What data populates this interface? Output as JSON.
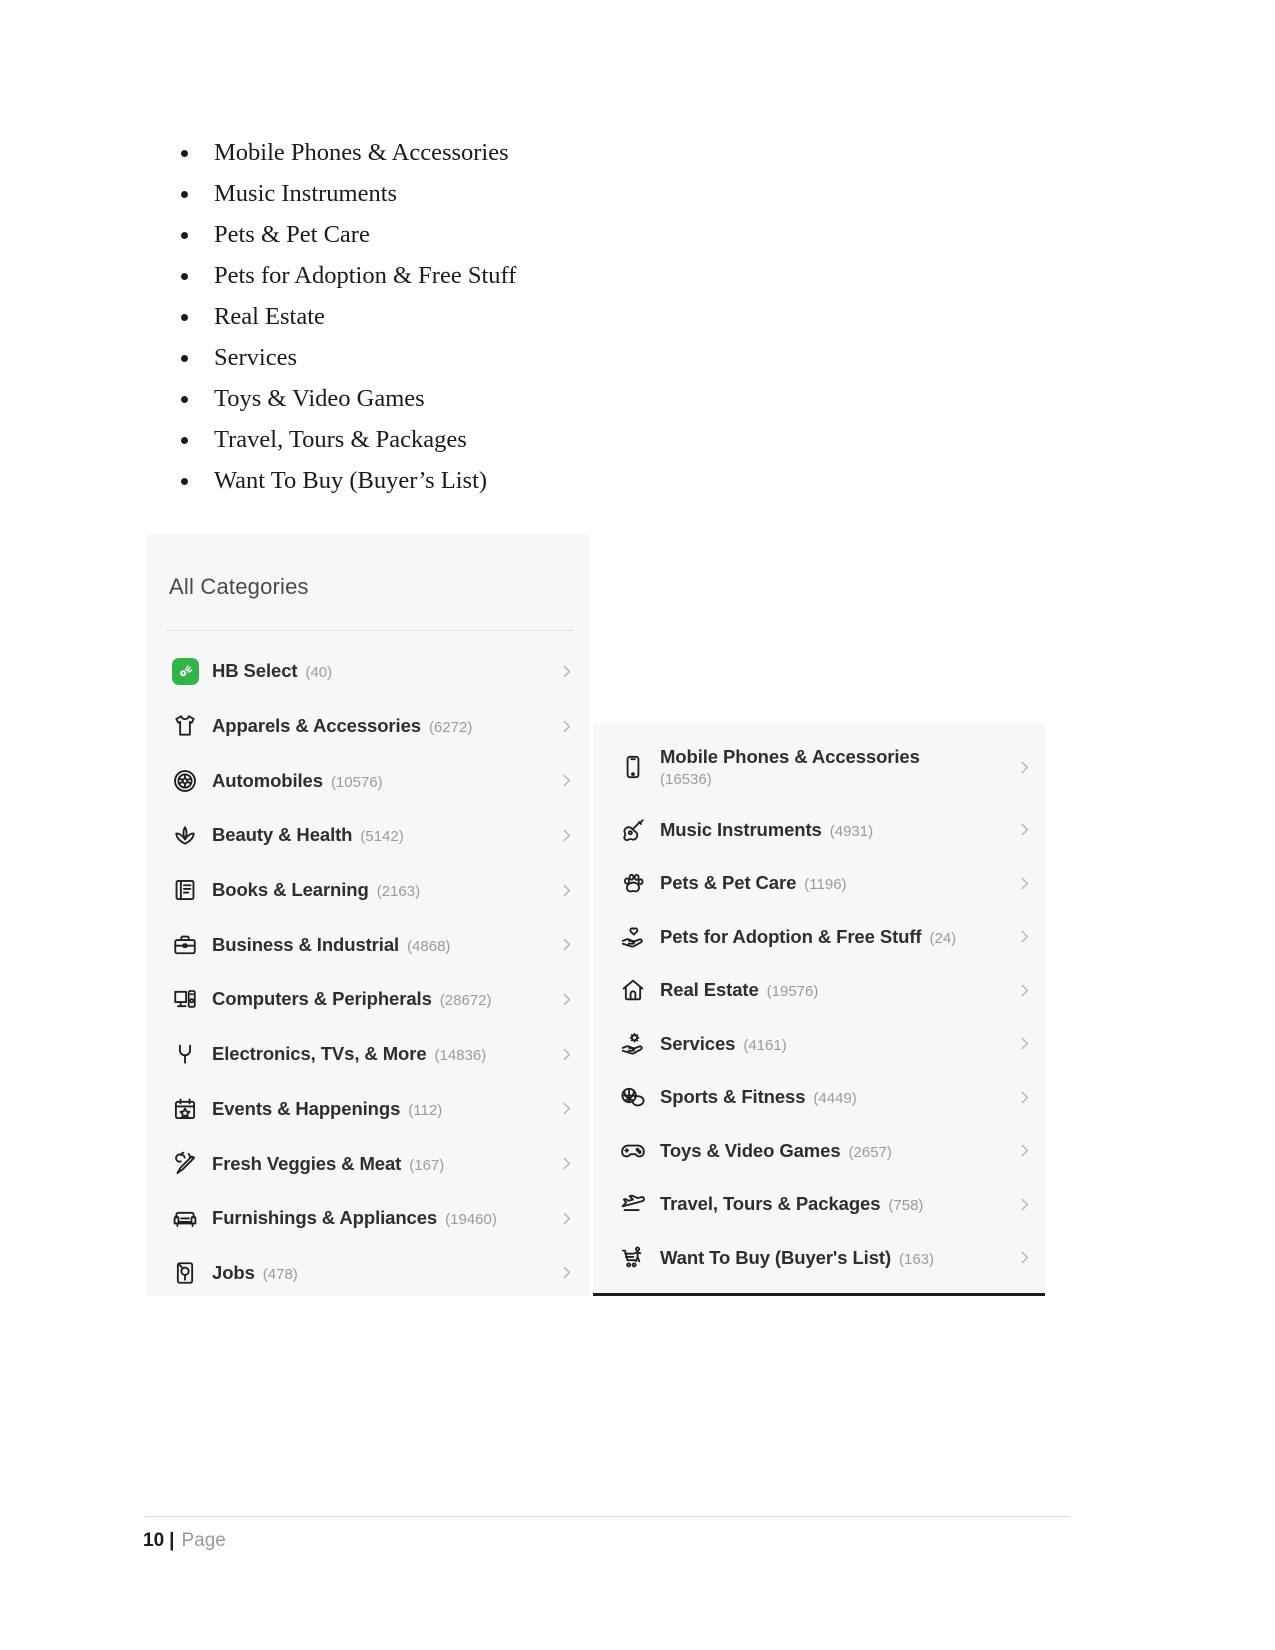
{
  "document": {
    "bullet_list": [
      "Mobile Phones & Accessories",
      "Music Instruments",
      "Pets & Pet Care",
      "Pets for Adoption & Free Stuff",
      "Real Estate",
      "Services",
      "Toys & Video Games",
      "Travel, Tours & Packages",
      "Want To Buy (Buyer’s List)"
    ],
    "footer": {
      "page_number": "10",
      "separator": "|",
      "label": "Page"
    }
  },
  "screenshot_left_panel": {
    "title": "All Categories",
    "accent_color": "#32b448",
    "background_color": "#f7f7f7",
    "items": [
      {
        "icon": "hb-select-icon",
        "label": "HB Select",
        "count": "(40)",
        "chevron": "chevron-right-icon"
      },
      {
        "icon": "tshirt-icon",
        "label": "Apparels & Accessories",
        "count": "(6272)",
        "chevron": "chevron-right-icon"
      },
      {
        "icon": "wheel-icon",
        "label": "Automobiles",
        "count": "(10576)",
        "chevron": "chevron-right-icon"
      },
      {
        "icon": "lotus-icon",
        "label": "Beauty & Health",
        "count": "(5142)",
        "chevron": "chevron-right-icon"
      },
      {
        "icon": "book-icon",
        "label": "Books & Learning",
        "count": "(2163)",
        "chevron": "chevron-right-icon"
      },
      {
        "icon": "briefcase-icon",
        "label": "Business & Industrial",
        "count": "(4868)",
        "chevron": "chevron-right-icon"
      },
      {
        "icon": "monitor-icon",
        "label": "Computers & Peripherals",
        "count": "(28672)",
        "chevron": "chevron-right-icon"
      },
      {
        "icon": "plug-icon",
        "label": "Electronics, TVs, & More",
        "count": "(14836)",
        "chevron": "chevron-right-icon"
      },
      {
        "icon": "calendar-star-icon",
        "label": "Events & Happenings",
        "count": "(112)",
        "chevron": "chevron-right-icon"
      },
      {
        "icon": "carrot-icon",
        "label": "Fresh Veggies & Meat",
        "count": "(167)",
        "chevron": "chevron-right-icon"
      },
      {
        "icon": "sofa-icon",
        "label": "Furnishings & Appliances",
        "count": "(19460)",
        "chevron": "chevron-right-icon"
      },
      {
        "icon": "jobs-icon",
        "label": "Jobs",
        "count": "(478)",
        "chevron": "chevron-right-icon"
      }
    ]
  },
  "screenshot_right_panel": {
    "background_color": "#f7f7f7",
    "items": [
      {
        "icon": "mobile-phone-icon",
        "label": "Mobile Phones & Accessories",
        "count": "(16536)",
        "chevron": "chevron-right-icon",
        "wraps": true
      },
      {
        "icon": "guitar-icon",
        "label": "Music Instruments",
        "count": "(4931)",
        "chevron": "chevron-right-icon",
        "wraps": false
      },
      {
        "icon": "paw-icon",
        "label": "Pets & Pet Care",
        "count": "(1196)",
        "chevron": "chevron-right-icon",
        "wraps": false
      },
      {
        "icon": "hand-heart-icon",
        "label": "Pets for Adoption & Free Stuff",
        "count": "(24)",
        "chevron": "chevron-right-icon",
        "wraps": false
      },
      {
        "icon": "home-icon",
        "label": "Real Estate",
        "count": "(19576)",
        "chevron": "chevron-right-icon",
        "wraps": false
      },
      {
        "icon": "hand-gear-icon",
        "label": "Services",
        "count": "(4161)",
        "chevron": "chevron-right-icon",
        "wraps": false
      },
      {
        "icon": "sports-ball-icon",
        "label": "Sports & Fitness",
        "count": "(4449)",
        "chevron": "chevron-right-icon",
        "wraps": false
      },
      {
        "icon": "gamepad-icon",
        "label": "Toys & Video Games",
        "count": "(2657)",
        "chevron": "chevron-right-icon",
        "wraps": false
      },
      {
        "icon": "airplane-icon",
        "label": "Travel, Tours & Packages",
        "count": "(758)",
        "chevron": "chevron-right-icon",
        "wraps": false
      },
      {
        "icon": "shopping-cart-person-icon",
        "label": "Want To Buy (Buyer's List)",
        "count": "(163)",
        "chevron": "chevron-right-icon",
        "wraps": false
      }
    ]
  }
}
